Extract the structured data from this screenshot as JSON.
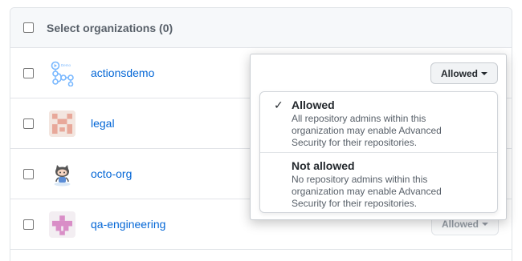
{
  "header": {
    "title": "Select organizations (0)"
  },
  "organizations": [
    {
      "name": "actionsdemo",
      "avatar_icon": "actions-demo-workflow-icon"
    },
    {
      "name": "legal",
      "avatar_icon": "identicon-pink"
    },
    {
      "name": "octo-org",
      "avatar_icon": "octocat-icon"
    },
    {
      "name": "qa-engineering",
      "avatar_icon": "identicon-magenta",
      "policy": "Allowed"
    }
  ],
  "popover": {
    "button_label": "Allowed",
    "options": [
      {
        "title": "Allowed",
        "selected": true,
        "description": "All repository admins within this organization may enable Advanced Security for their repositories."
      },
      {
        "title": "Not allowed",
        "selected": false,
        "description": "No repository admins within this organization may enable Advanced Security for their repositories."
      }
    ]
  },
  "colors": {
    "link": "#0366d6",
    "border": "#e1e4e8",
    "header_bg": "#f6f8fa"
  }
}
